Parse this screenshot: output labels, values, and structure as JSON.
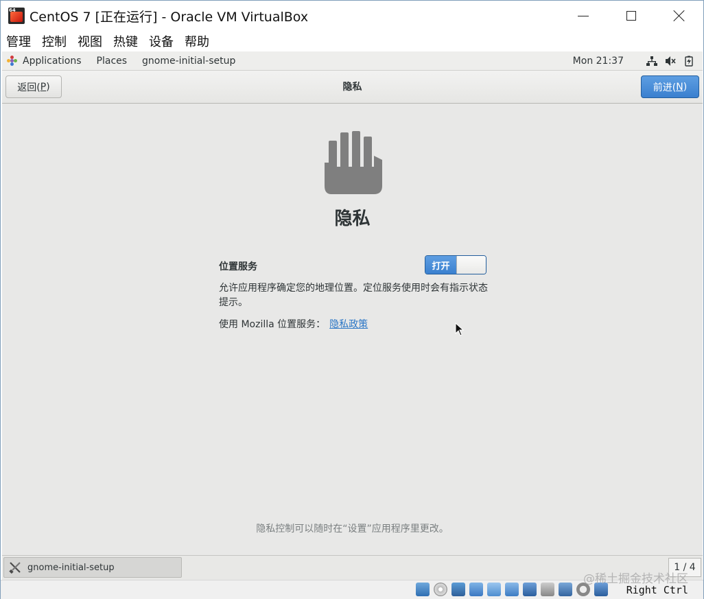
{
  "window": {
    "title": "CentOS 7 [正在运行] - Oracle VM VirtualBox"
  },
  "menubar": {
    "items": [
      "管理",
      "控制",
      "视图",
      "热键",
      "设备",
      "帮助"
    ]
  },
  "gnome_panel": {
    "applications": "Applications",
    "places": "Places",
    "active_app": "gnome-initial-setup",
    "clock": "Mon 21:37",
    "tray_icons": [
      "network-icon",
      "volume-muted-icon",
      "battery-icon"
    ]
  },
  "header": {
    "back_label": "返回(",
    "back_key": "P",
    "back_close": ")",
    "title": "隐私",
    "next_label": "前进(",
    "next_key": "N",
    "next_close": ")"
  },
  "page": {
    "icon": "hand-icon",
    "heading": "隐私",
    "location_label": "位置服务",
    "toggle_label": "打开",
    "toggle_state": "on",
    "description": "允许应用程序确定您的地理位置。定位服务使用时会有指示状态提示。",
    "mozilla_text": "使用 Mozilla 位置服务：",
    "policy_link": "隐私政策",
    "footer_note": "隐私控制可以随时在“设置”应用程序里更改。"
  },
  "taskbar": {
    "window_label": "gnome-initial-setup",
    "workspace": "1 / 4"
  },
  "statusbar": {
    "host_key": "Right Ctrl",
    "watermark": "@稀土掘金技术社区"
  },
  "colors": {
    "accent": "#3a80cf",
    "link": "#2a76c6",
    "background": "#e8e8e7"
  }
}
